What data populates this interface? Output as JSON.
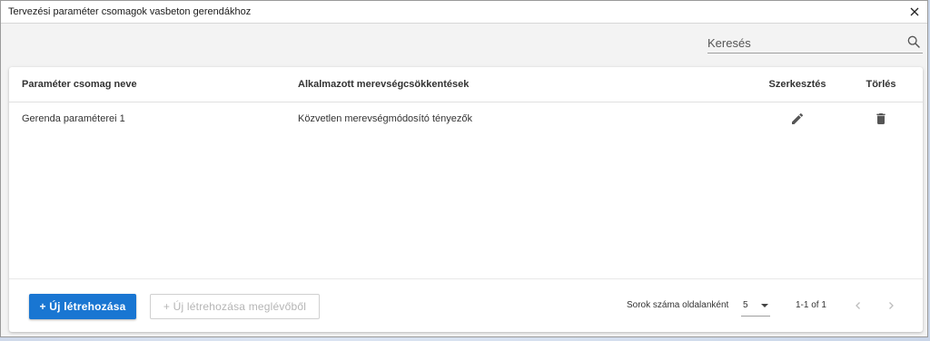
{
  "window": {
    "title": "Tervezési paraméter csomagok vasbeton gerendákhoz",
    "close_icon": "close-icon"
  },
  "search": {
    "placeholder": "Keresés",
    "value": "",
    "icon": "search-icon"
  },
  "table": {
    "headers": {
      "name": "Paraméter csomag neve",
      "stiffness": "Alkalmazott merevségcsökkentések",
      "edit": "Szerkesztés",
      "delete": "Törlés"
    },
    "rows": [
      {
        "name": "Gerenda paraméterei 1",
        "stiffness": "Közvetlen merevségmódosító tényezők",
        "edit_icon": "pencil-icon",
        "delete_icon": "trash-icon"
      }
    ]
  },
  "footer": {
    "create_label": "+ Új létrehozása",
    "create_from_existing_label": "+ Új létrehozása meglévőből",
    "rows_per_page_label": "Sorok száma oldalanként",
    "rows_per_page_value": "5",
    "page_info": "1-1 of 1"
  },
  "colors": {
    "primary": "#1976d2",
    "disabled_text": "#b5b5b5"
  }
}
